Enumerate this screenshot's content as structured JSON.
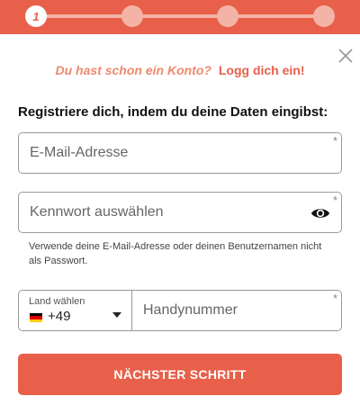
{
  "stepper": {
    "current_step": "1",
    "total_steps": 4
  },
  "login": {
    "question": "Du hast schon ein Konto?",
    "link": "Logg dich ein!"
  },
  "form": {
    "heading": "Registriere dich, indem du deine Daten eingibst:",
    "email_placeholder": "E-Mail-Adresse",
    "password_placeholder": "Kennwort auswählen",
    "required_mark": "*",
    "password_hint": "Verwende deine E-Mail-Adresse oder deinen Benutzernamen nicht als Passwort.",
    "country_label": "Land wählen",
    "country_code": "+49",
    "phone_placeholder": "Handynummer",
    "next_button": "NÄCHSTER SCHRITT"
  },
  "icons": {
    "close": "close-icon",
    "eye": "eye-icon",
    "flag": "germany-flag-icon",
    "caret": "caret-down-icon"
  },
  "colors": {
    "accent": "#e8604a",
    "accent_light": "#f3b3a6",
    "accent_text": "#ee8a6f"
  }
}
